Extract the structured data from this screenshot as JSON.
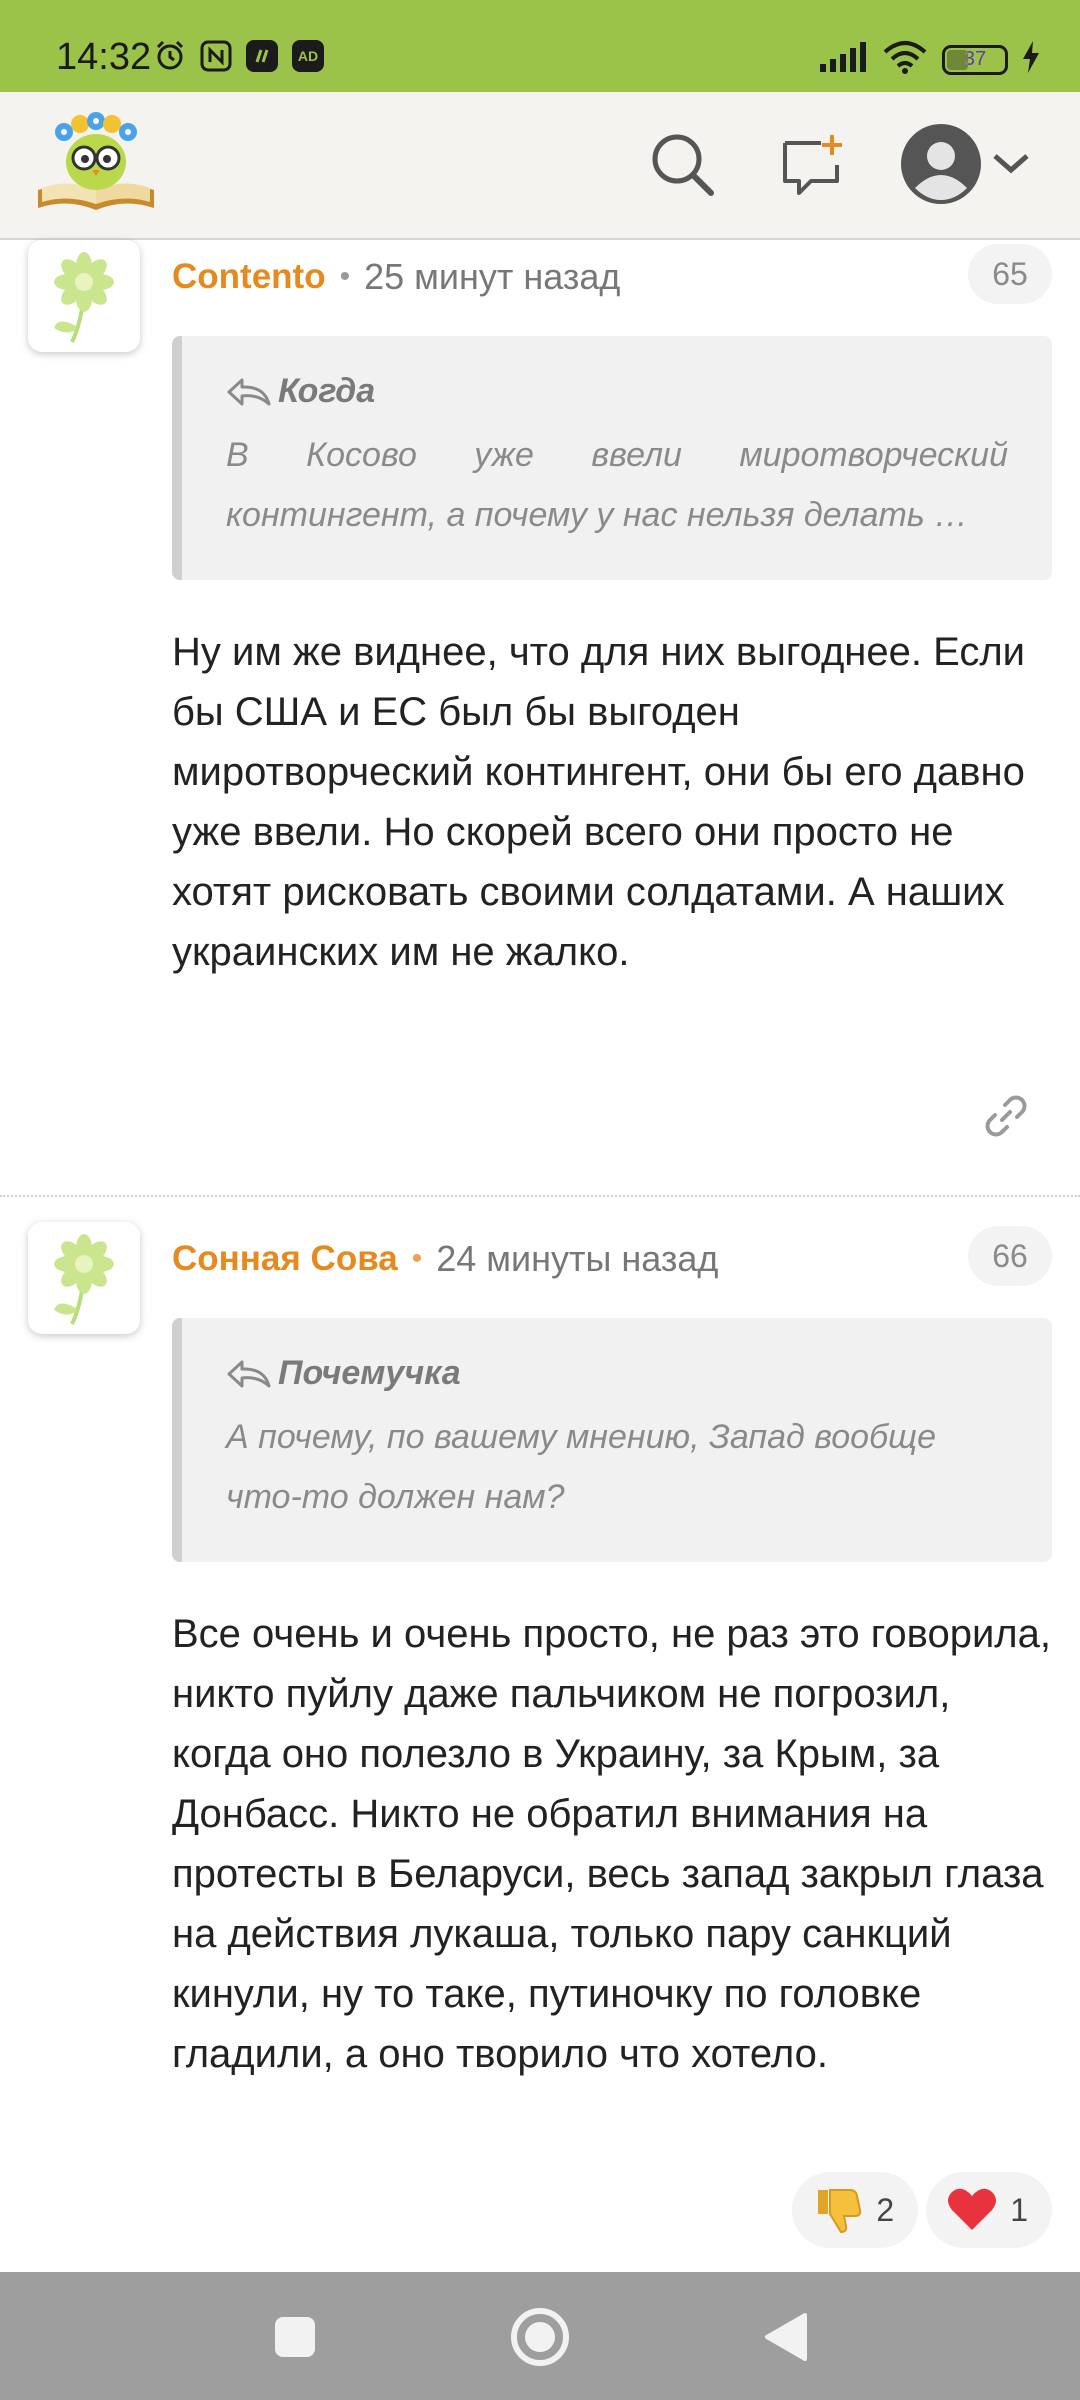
{
  "status_bar": {
    "time": "14:32",
    "icons": [
      "alarm-icon",
      "nfc-icon",
      "app-notification-icon",
      "ad-blocker-icon"
    ],
    "battery_level": "37",
    "battery_fraction": 0.37,
    "ad_badge": "AD"
  },
  "header": {
    "logo": "owl-book-logo",
    "buttons": [
      "search-icon",
      "new-comment-icon",
      "user-avatar-icon",
      "chevron-down-icon"
    ]
  },
  "comments": [
    {
      "author": "Contento",
      "separator": "•",
      "time": "25 минут назад",
      "number": "65",
      "quote_author": "Когда",
      "quote_text": "В Косово уже ввели миротворческий контингент, а почему у нас нельзя делать …",
      "body": "Ну им же виднее, что для них выгоднее. Если бы США и ЕС был бы выгоден миротворческий контингент, они бы его давно уже ввели. Но скорей всего они просто не хотят рисковать своими солдатами. А наших украинских им не жалко."
    },
    {
      "author": "Сонная Сова",
      "separator": "•",
      "time": "24 минуты назад",
      "number": "66",
      "quote_author": "Почемучка",
      "quote_text": "А почему, по вашему мнению, Запад вообще что-то должен нам?",
      "body": "Все очень и очень просто, не раз это говорила, никто пуйлу даже пальчиком не погрозил, когда оно полезло в Украину, за Крым, за Донбасс. Никто не обратил внимания на протесты в Беларуси, весь запад закрыл глаза на действия лукаша, только пару санкций кинули, ну то таке, путиночку по головке гладили, а оно творило что хотело.",
      "reactions": [
        {
          "icon": "thumbs-down-icon",
          "count": "2"
        },
        {
          "icon": "heart-icon",
          "count": "1"
        }
      ]
    }
  ],
  "nav_bar": {
    "buttons": [
      "recents-square-icon",
      "home-circle-icon",
      "back-triangle-icon"
    ]
  },
  "colors": {
    "status_bar": "#9bc349",
    "author": "#e58a1f",
    "header_bg": "#f4f3ef",
    "nav_bar": "#9e9e9e"
  }
}
